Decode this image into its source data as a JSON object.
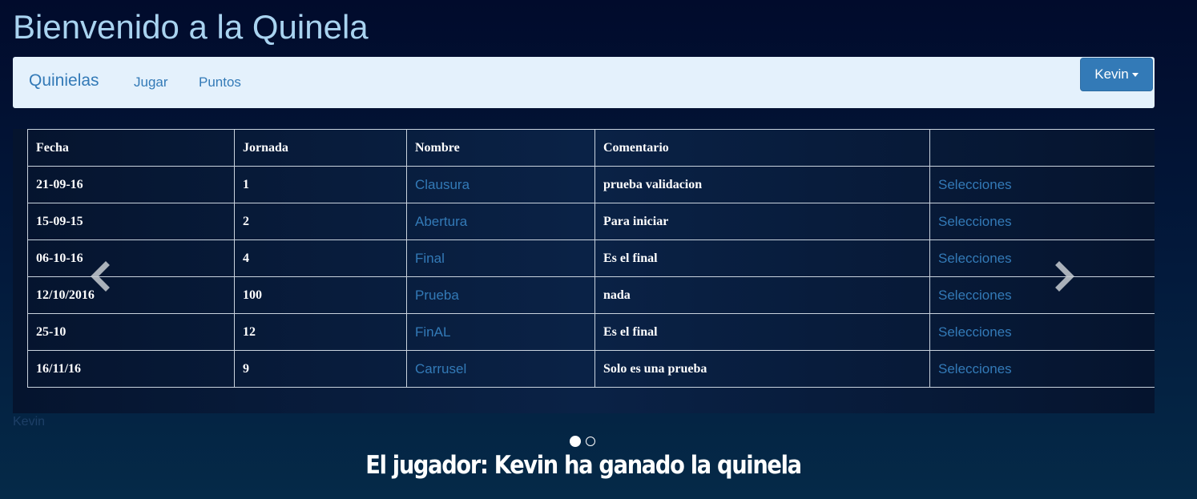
{
  "header": {
    "title": "Bienvenido a la Quinela"
  },
  "navbar": {
    "brand": "Quinielas",
    "links": [
      "Jugar",
      "Puntos"
    ],
    "user_button": "Kevin"
  },
  "table": {
    "columns": [
      "Fecha",
      "Jornada",
      "Nombre",
      "Comentario",
      ""
    ],
    "rows": [
      {
        "fecha": "21-09-16",
        "jornada": "1",
        "nombre": "Clausura",
        "comentario": "prueba validacion",
        "accion": "Selecciones"
      },
      {
        "fecha": "15-09-15",
        "jornada": "2",
        "nombre": "Abertura",
        "comentario": "Para iniciar",
        "accion": "Selecciones"
      },
      {
        "fecha": "06-10-16",
        "jornada": "4",
        "nombre": "Final",
        "comentario": "Es el final",
        "accion": "Selecciones"
      },
      {
        "fecha": "12/10/2016",
        "jornada": "100",
        "nombre": "Prueba",
        "comentario": "nada",
        "accion": "Selecciones"
      },
      {
        "fecha": "25-10",
        "jornada": "12",
        "nombre": "FinAL",
        "comentario": "Es el final",
        "accion": "Selecciones"
      },
      {
        "fecha": "16/11/16",
        "jornada": "9",
        "nombre": "Carrusel",
        "comentario": "Solo es una prueba",
        "accion": "Selecciones"
      }
    ]
  },
  "carousel": {
    "caption_user": "Kevin",
    "prev_icon": "chevron-left-icon",
    "next_icon": "chevron-right-icon",
    "slide_count": 2,
    "active_slide": 1
  },
  "footer": {
    "winner_text": "El jugador: Kevin ha ganado la quinela"
  },
  "colors": {
    "link": "#337ab7",
    "navbar_bg": "#e4f1fc",
    "title": "#a9d3f0"
  }
}
